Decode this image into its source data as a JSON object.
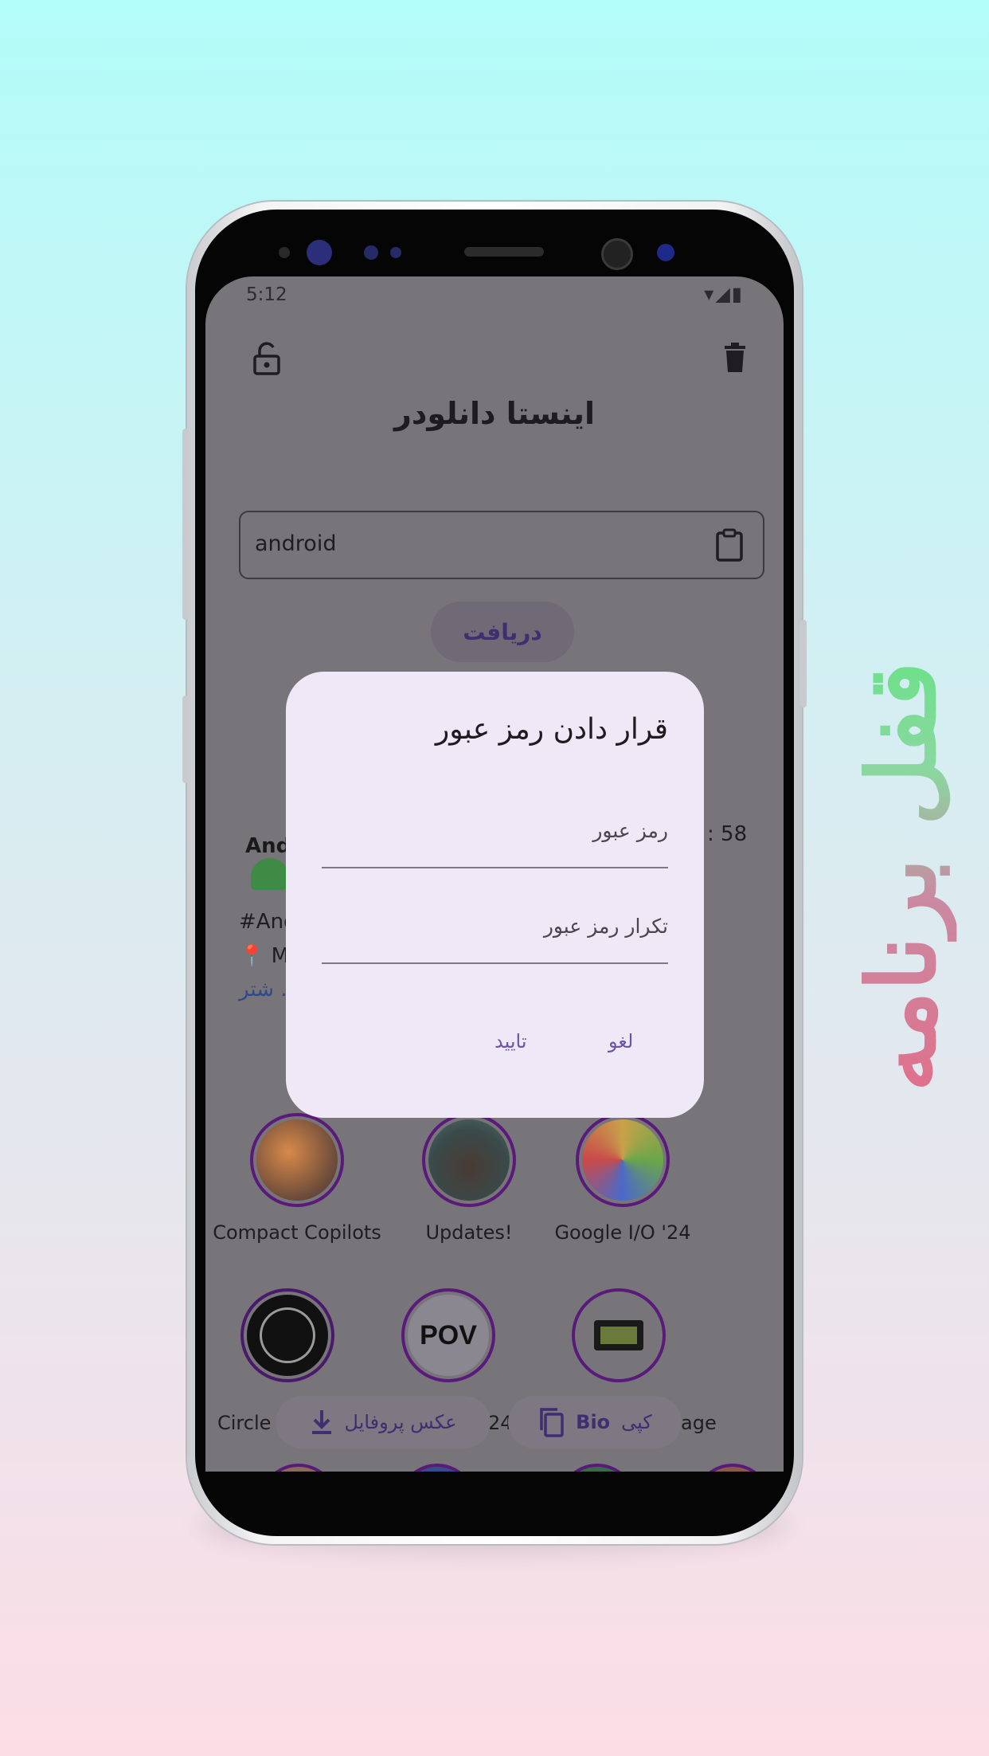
{
  "promo": {
    "text": "قفل برنامه"
  },
  "status_bar": {
    "time": "5:12",
    "icons": [
      "wifi-icon",
      "signal-icon",
      "battery-icon"
    ]
  },
  "app": {
    "title": "اینستا دانلودر",
    "lock_icon": "unlock-icon",
    "delete_icon": "trash-icon",
    "search": {
      "value": "android",
      "clipboard_icon": "clipboard-icon"
    },
    "fetch_button": "دریافت"
  },
  "profile": {
    "name_partial": "Andr",
    "hashtag_partial": "#Andr",
    "location_partial": "📍 Mo",
    "more_partial": "... شتر",
    "stat_partial": ": 58"
  },
  "stories": {
    "row1": [
      "Compact Copilots",
      "Updates!",
      "Google I/O '24"
    ],
    "row2": [
      "Circle",
      "24",
      "age"
    ]
  },
  "bottom_actions": {
    "profile_photo": "عکس پروفایل",
    "copy_bio_bio": "Bio",
    "copy_bio_verb": "کپی"
  },
  "dialog": {
    "title": "قرار دادن رمز عبور",
    "password_placeholder": "رمز عبور",
    "confirm_placeholder": "تکرار رمز عبور",
    "confirm_button": "تایید",
    "cancel_button": "لغو"
  },
  "colors": {
    "scrim": "#77747a",
    "dialog_bg": "#efe8f6",
    "accent": "#6a55a8",
    "story_ring": "#5a1a7a"
  }
}
